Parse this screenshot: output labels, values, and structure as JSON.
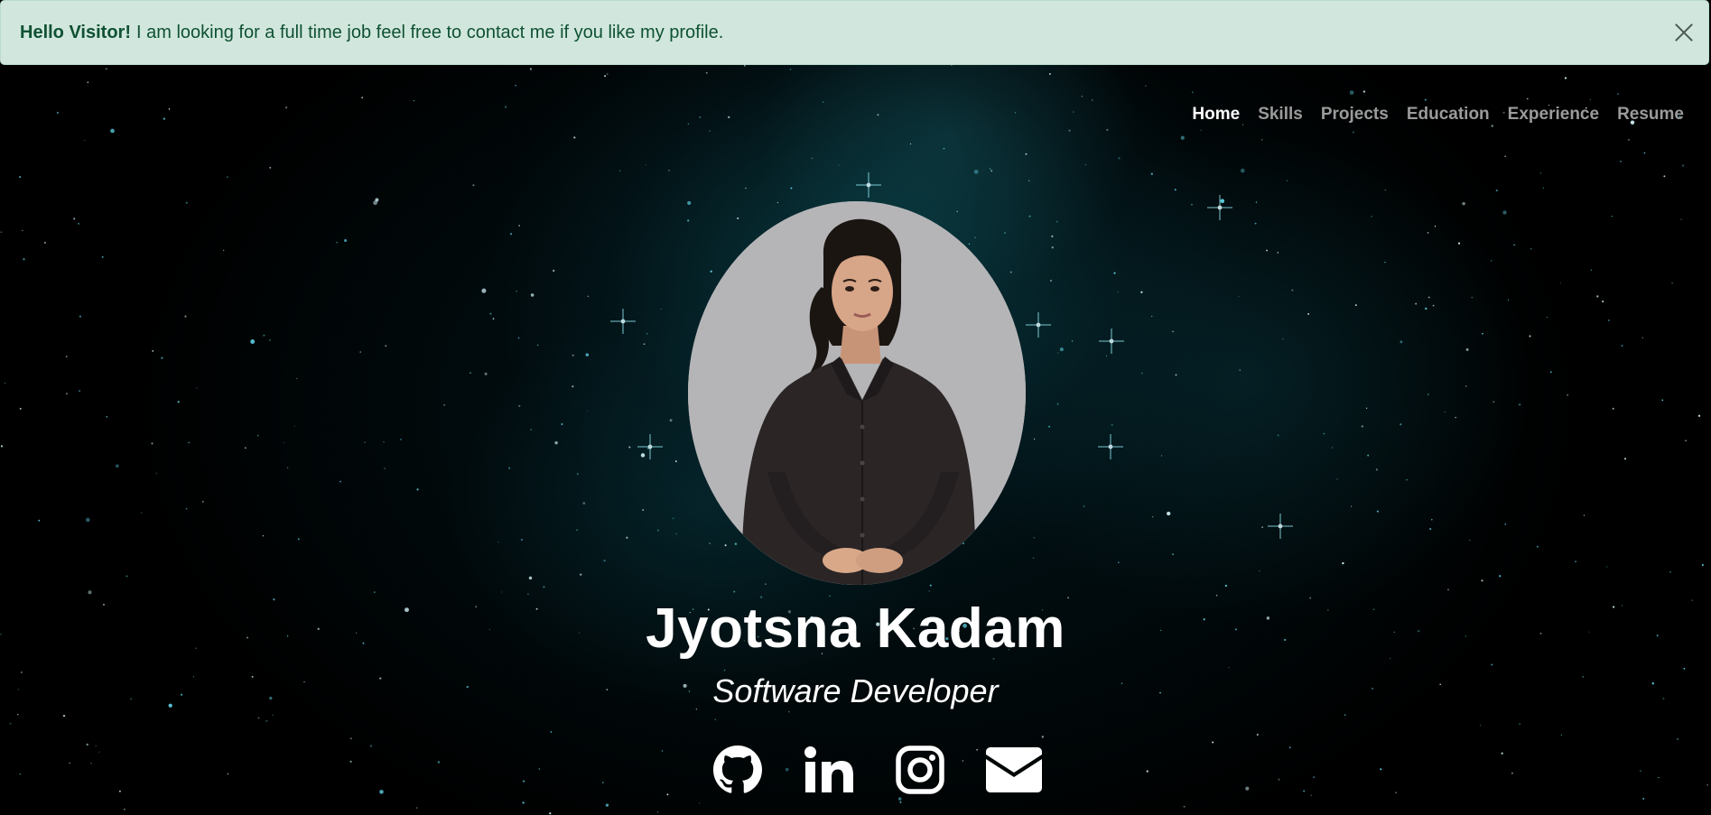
{
  "alert": {
    "title": "Hello Visitor!",
    "message": "I am looking for a full time job feel free to contact me if you like my profile.",
    "close_icon": "close-icon",
    "background": "#d1e7dd",
    "text_color": "#0f5132"
  },
  "nav": {
    "items": [
      {
        "label": "Home",
        "active": true
      },
      {
        "label": "Skills",
        "active": false
      },
      {
        "label": "Projects",
        "active": false
      },
      {
        "label": "Education",
        "active": false
      },
      {
        "label": "Experience",
        "active": false
      },
      {
        "label": "Resume",
        "active": false
      }
    ]
  },
  "hero": {
    "name": "Jyotsna Kadam",
    "role": "Software Developer",
    "avatar": "profile-photo"
  },
  "socials": [
    {
      "icon": "github-icon"
    },
    {
      "icon": "linkedin-icon"
    },
    {
      "icon": "instagram-icon"
    },
    {
      "icon": "email-icon"
    }
  ],
  "colors": {
    "background": "#000000",
    "accent_glow": "#0e5862",
    "nav_inactive": "#9b9b9b",
    "nav_active": "#ffffff"
  }
}
